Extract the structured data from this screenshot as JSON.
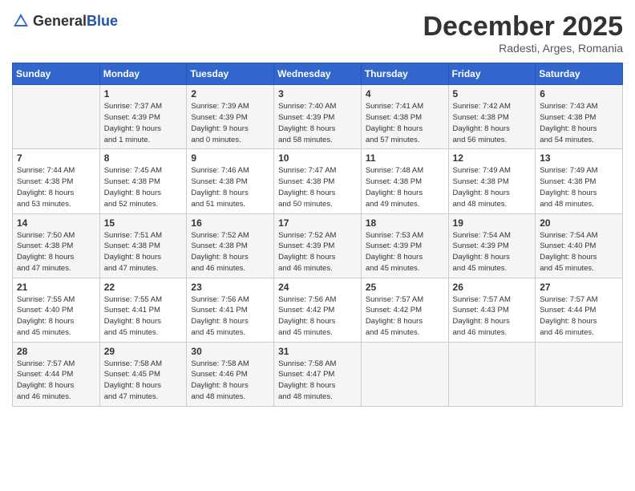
{
  "header": {
    "logo_general": "General",
    "logo_blue": "Blue",
    "month": "December 2025",
    "location": "Radesti, Arges, Romania"
  },
  "days_of_week": [
    "Sunday",
    "Monday",
    "Tuesday",
    "Wednesday",
    "Thursday",
    "Friday",
    "Saturday"
  ],
  "weeks": [
    [
      {
        "day": "",
        "info": ""
      },
      {
        "day": "1",
        "info": "Sunrise: 7:37 AM\nSunset: 4:39 PM\nDaylight: 9 hours\nand 1 minute."
      },
      {
        "day": "2",
        "info": "Sunrise: 7:39 AM\nSunset: 4:39 PM\nDaylight: 9 hours\nand 0 minutes."
      },
      {
        "day": "3",
        "info": "Sunrise: 7:40 AM\nSunset: 4:39 PM\nDaylight: 8 hours\nand 58 minutes."
      },
      {
        "day": "4",
        "info": "Sunrise: 7:41 AM\nSunset: 4:38 PM\nDaylight: 8 hours\nand 57 minutes."
      },
      {
        "day": "5",
        "info": "Sunrise: 7:42 AM\nSunset: 4:38 PM\nDaylight: 8 hours\nand 56 minutes."
      },
      {
        "day": "6",
        "info": "Sunrise: 7:43 AM\nSunset: 4:38 PM\nDaylight: 8 hours\nand 54 minutes."
      }
    ],
    [
      {
        "day": "7",
        "info": "Sunrise: 7:44 AM\nSunset: 4:38 PM\nDaylight: 8 hours\nand 53 minutes."
      },
      {
        "day": "8",
        "info": "Sunrise: 7:45 AM\nSunset: 4:38 PM\nDaylight: 8 hours\nand 52 minutes."
      },
      {
        "day": "9",
        "info": "Sunrise: 7:46 AM\nSunset: 4:38 PM\nDaylight: 8 hours\nand 51 minutes."
      },
      {
        "day": "10",
        "info": "Sunrise: 7:47 AM\nSunset: 4:38 PM\nDaylight: 8 hours\nand 50 minutes."
      },
      {
        "day": "11",
        "info": "Sunrise: 7:48 AM\nSunset: 4:38 PM\nDaylight: 8 hours\nand 49 minutes."
      },
      {
        "day": "12",
        "info": "Sunrise: 7:49 AM\nSunset: 4:38 PM\nDaylight: 8 hours\nand 48 minutes."
      },
      {
        "day": "13",
        "info": "Sunrise: 7:49 AM\nSunset: 4:38 PM\nDaylight: 8 hours\nand 48 minutes."
      }
    ],
    [
      {
        "day": "14",
        "info": "Sunrise: 7:50 AM\nSunset: 4:38 PM\nDaylight: 8 hours\nand 47 minutes."
      },
      {
        "day": "15",
        "info": "Sunrise: 7:51 AM\nSunset: 4:38 PM\nDaylight: 8 hours\nand 47 minutes."
      },
      {
        "day": "16",
        "info": "Sunrise: 7:52 AM\nSunset: 4:38 PM\nDaylight: 8 hours\nand 46 minutes."
      },
      {
        "day": "17",
        "info": "Sunrise: 7:52 AM\nSunset: 4:39 PM\nDaylight: 8 hours\nand 46 minutes."
      },
      {
        "day": "18",
        "info": "Sunrise: 7:53 AM\nSunset: 4:39 PM\nDaylight: 8 hours\nand 45 minutes."
      },
      {
        "day": "19",
        "info": "Sunrise: 7:54 AM\nSunset: 4:39 PM\nDaylight: 8 hours\nand 45 minutes."
      },
      {
        "day": "20",
        "info": "Sunrise: 7:54 AM\nSunset: 4:40 PM\nDaylight: 8 hours\nand 45 minutes."
      }
    ],
    [
      {
        "day": "21",
        "info": "Sunrise: 7:55 AM\nSunset: 4:40 PM\nDaylight: 8 hours\nand 45 minutes."
      },
      {
        "day": "22",
        "info": "Sunrise: 7:55 AM\nSunset: 4:41 PM\nDaylight: 8 hours\nand 45 minutes."
      },
      {
        "day": "23",
        "info": "Sunrise: 7:56 AM\nSunset: 4:41 PM\nDaylight: 8 hours\nand 45 minutes."
      },
      {
        "day": "24",
        "info": "Sunrise: 7:56 AM\nSunset: 4:42 PM\nDaylight: 8 hours\nand 45 minutes."
      },
      {
        "day": "25",
        "info": "Sunrise: 7:57 AM\nSunset: 4:42 PM\nDaylight: 8 hours\nand 45 minutes."
      },
      {
        "day": "26",
        "info": "Sunrise: 7:57 AM\nSunset: 4:43 PM\nDaylight: 8 hours\nand 46 minutes."
      },
      {
        "day": "27",
        "info": "Sunrise: 7:57 AM\nSunset: 4:44 PM\nDaylight: 8 hours\nand 46 minutes."
      }
    ],
    [
      {
        "day": "28",
        "info": "Sunrise: 7:57 AM\nSunset: 4:44 PM\nDaylight: 8 hours\nand 46 minutes."
      },
      {
        "day": "29",
        "info": "Sunrise: 7:58 AM\nSunset: 4:45 PM\nDaylight: 8 hours\nand 47 minutes."
      },
      {
        "day": "30",
        "info": "Sunrise: 7:58 AM\nSunset: 4:46 PM\nDaylight: 8 hours\nand 48 minutes."
      },
      {
        "day": "31",
        "info": "Sunrise: 7:58 AM\nSunset: 4:47 PM\nDaylight: 8 hours\nand 48 minutes."
      },
      {
        "day": "",
        "info": ""
      },
      {
        "day": "",
        "info": ""
      },
      {
        "day": "",
        "info": ""
      }
    ]
  ]
}
